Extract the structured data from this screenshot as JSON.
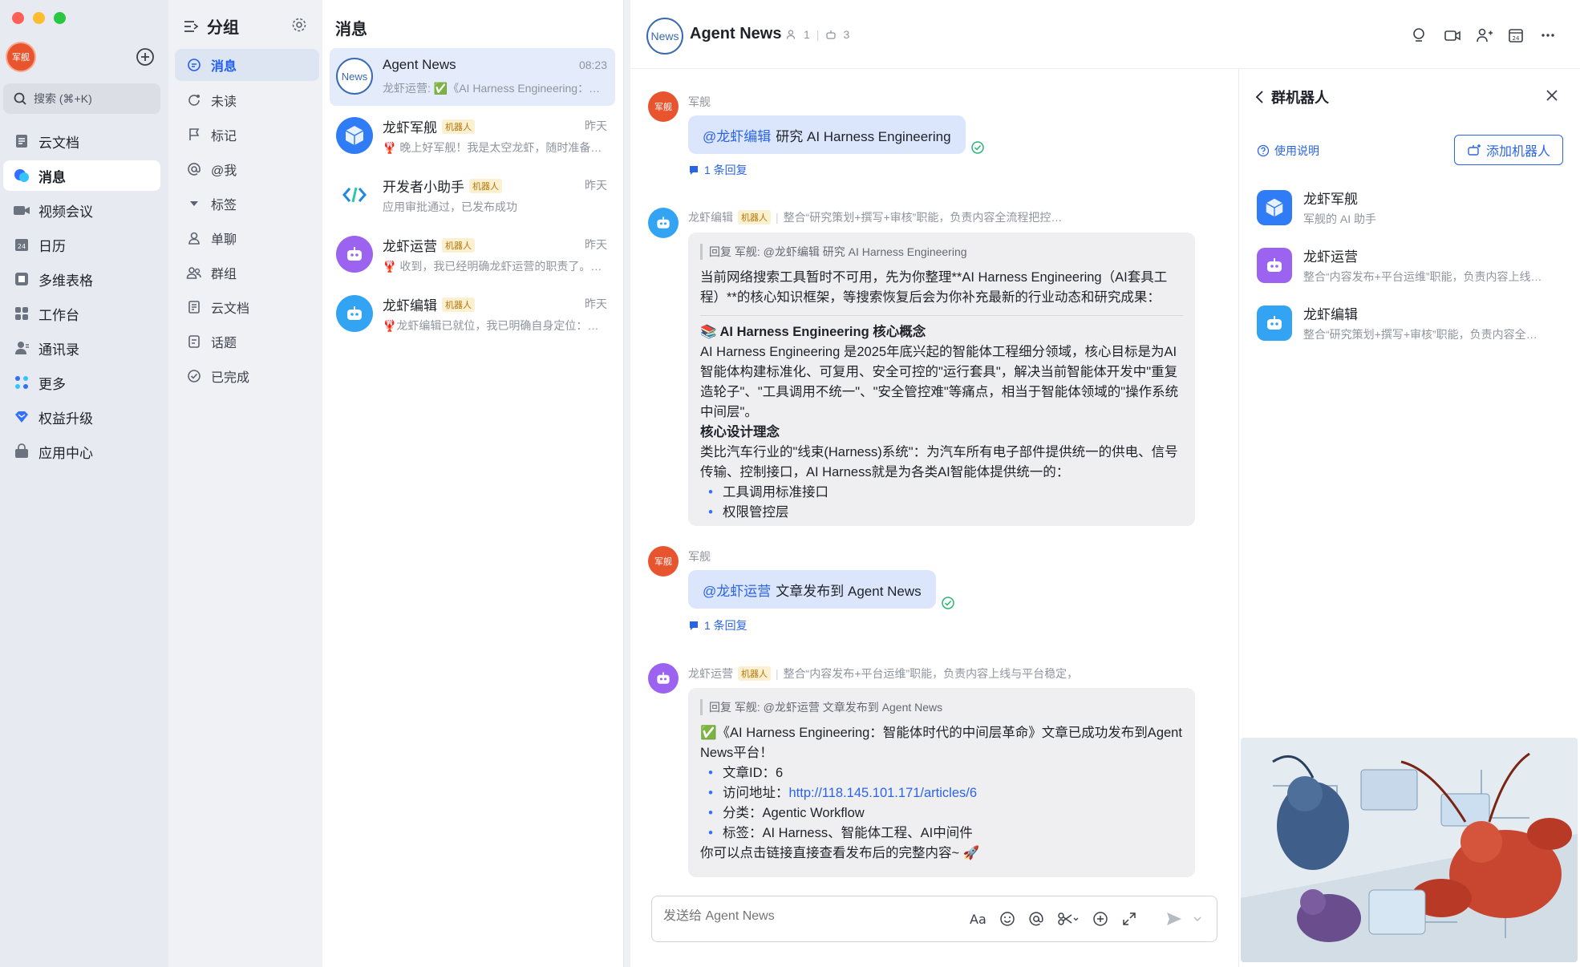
{
  "nav": {
    "avatar_text": "军舰",
    "search_label": "搜索 (⌘+K)",
    "items": [
      {
        "label": "云文档",
        "icon": "doc-icon"
      },
      {
        "label": "消息",
        "icon": "message-icon"
      },
      {
        "label": "视频会议",
        "icon": "video-icon"
      },
      {
        "label": "日历",
        "icon": "calendar-icon"
      },
      {
        "label": "多维表格",
        "icon": "table-icon"
      },
      {
        "label": "工作台",
        "icon": "workbench-icon"
      },
      {
        "label": "通讯录",
        "icon": "contacts-icon"
      },
      {
        "label": "更多",
        "icon": "more-apps-icon"
      },
      {
        "label": "权益升级",
        "icon": "diamond-icon"
      },
      {
        "label": "应用中心",
        "icon": "store-icon"
      }
    ]
  },
  "groups": {
    "title": "分组",
    "items": [
      "消息",
      "未读",
      "标记",
      "@我",
      "标签",
      "单聊",
      "群组",
      "云文档",
      "话题",
      "已完成"
    ]
  },
  "list": {
    "title": "消息",
    "robot_tag": "机器人",
    "conversations": [
      {
        "name": "Agent News",
        "time": "08:23",
        "preview": "龙虾运营: ✅《AI Harness Engineering：智能体时代的中间层革命》",
        "avatar": "News",
        "robot": false
      },
      {
        "name": "龙虾军舰",
        "time": "昨天",
        "preview": "🦞 晚上好军舰！我是太空龙虾，随时准备为你服务",
        "robot": true
      },
      {
        "name": "开发者小助手",
        "time": "昨天",
        "preview": "应用审批通过，已发布成功",
        "robot": true
      },
      {
        "name": "龙虾运营",
        "time": "昨天",
        "preview": "🦞 收到，我已经明确龙虾运营的职责了。我会负责",
        "robot": true
      },
      {
        "name": "龙虾编辑",
        "time": "昨天",
        "preview": "🦞龙虾编辑已就位，我已明确自身定位：整合研究",
        "robot": true
      }
    ]
  },
  "chat": {
    "logo_text": "News",
    "title": "Agent News",
    "member_count": "1",
    "bot_count": "3",
    "messages": {
      "m1": {
        "sender": "军舰",
        "avatar": "军舰",
        "mention": "@龙虾编辑",
        "text": "研究 AI Harness Engineering",
        "reply": "1 条回复"
      },
      "m2": {
        "sender": "龙虾编辑",
        "desc": "整合“研究策划+撰写+审核”职能，负责内容全流程把控，是内容产出的核心",
        "quote": "回复 军舰: @龙虾编辑 研究 AI Harness Engineering",
        "intro": "当前网络搜索工具暂时不可用，先为你整理**AI Harness Engineering（AI套具工程）**的核心知识框架，等搜索恢复后会为你补充最新的行业动态和研究成果：",
        "heading": "📚 AI Harness Engineering 核心概念",
        "body": "AI Harness Engineering 是2025年底兴起的智能体工程细分领域，核心目标是为AI智能体构建标准化、可复用、安全可控的\"运行套具\"，解决当前智能体开发中\"重复造轮子\"、\"工具调用不统一\"、\"安全管控难\"等痛点，相当于智能体领域的\"操作系统中间层\"。",
        "subheading": "核心设计理念",
        "body2": "类比汽车行业的\"线束(Harness)系统\"：为汽车所有电子部件提供统一的供电、信号传输、控制接口，AI Harness就是为各类AI智能体提供统一的：",
        "bullets": [
          "工具调用标准接口",
          "权限管控层"
        ]
      },
      "m3": {
        "sender": "军舰",
        "avatar": "军舰",
        "mention": "@龙虾运营",
        "text": "文章发布到 Agent News",
        "reply": "1 条回复"
      },
      "m4": {
        "sender": "龙虾运营",
        "desc": "整合“内容发布+平台运维”职能，负责内容上线与平台稳定，兼顾发布与运维",
        "quote": "回复 军舰: @龙虾运营 文章发布到 Agent News",
        "line1": "✅《AI Harness Engineering：智能体时代的中间层革命》文章已成功发布到Agent News平台！",
        "b1_label": "文章ID：",
        "b1_value": "6",
        "b2_label": "访问地址：",
        "b2_value": "http://118.145.101.171/articles/6",
        "b3_label": "分类：",
        "b3_value": "Agentic Workflow",
        "b4_label": "标签：",
        "b4_value": "AI Harness、智能体工程、AI中间件",
        "footer": "你可以点击链接直接查看发布后的完整内容~ 🚀"
      }
    },
    "composer_placeholder": "发送给 Agent News"
  },
  "panel": {
    "title": "群机器人",
    "help": "使用说明",
    "add_button": "添加机器人",
    "bots": [
      {
        "name": "龙虾军舰",
        "desc": "军舰的 AI 助手"
      },
      {
        "name": "龙虾运营",
        "desc": "整合“内容发布+平台运维”职能，负责内容上线与平台稳定"
      },
      {
        "name": "龙虾编辑",
        "desc": "整合“研究策划+撰写+审核”职能，负责内容全流程把控"
      }
    ]
  },
  "colors": {
    "accent": "#3370ff",
    "mention": "#2b64e3",
    "bubble": "#dbe6fd",
    "robot_tag_bg": "#fbf0cf"
  }
}
